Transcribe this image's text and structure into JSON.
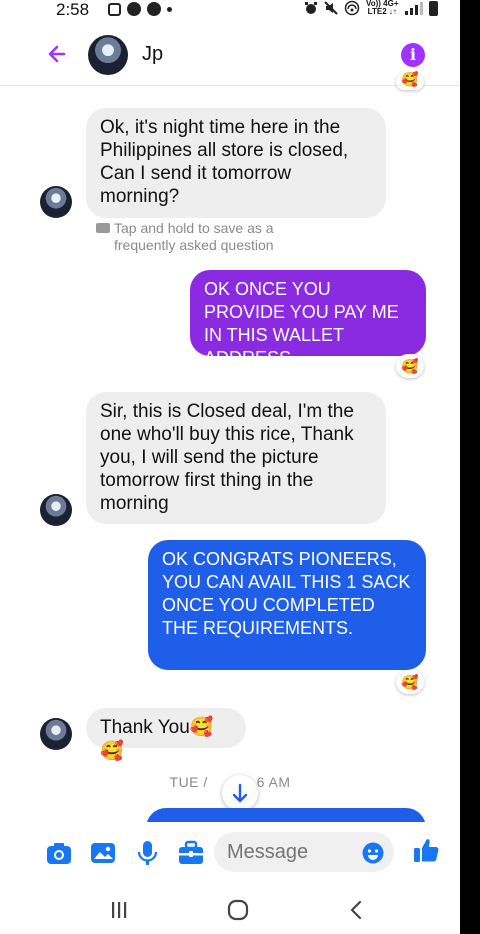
{
  "status_bar": {
    "time": "2:58",
    "network_top": "Vo)) 4G+",
    "network_bottom": "LTE2 ↓↑"
  },
  "header": {
    "contact_name": "Jp"
  },
  "messages": [
    {
      "direction": "incoming",
      "text": "Ok, it's night time here in the Philippines all store is closed, Can I send it tomorrow morning?"
    },
    {
      "direction": "outgoing",
      "text": "OK ONCE YOU PROVIDE YOU PAY ME IN THIS WALLET ADDRESS",
      "reaction": "🥰"
    },
    {
      "direction": "incoming",
      "text": "Sir, this is Closed deal, I'm the one who'll buy this rice, Thank you, I will send the picture tomorrow first thing in the morning"
    },
    {
      "direction": "outgoing",
      "text": "OK CONGRATS PIONEERS, YOU CAN AVAIL THIS 1 SACK ONCE YOU COMPLETED THE REQUIREMENTS.",
      "reaction": "🥰"
    },
    {
      "direction": "incoming",
      "text": "Thank You🥰🥰"
    }
  ],
  "faq_hint": {
    "line1": "Tap and hold to save as a",
    "line2": "frequently asked question"
  },
  "timestamp": {
    "left": "TUE /",
    "right": "6 AM"
  },
  "composer": {
    "placeholder": "Message"
  },
  "colors": {
    "accent_purple": "#a033ff",
    "outgoing_purple": "#8a2be2",
    "outgoing_blue": "#1e5ee8",
    "messenger_blue": "#1877f2"
  },
  "icons": [
    "back-arrow-icon",
    "info-icon",
    "camera-icon",
    "gallery-icon",
    "microphone-icon",
    "toolbox-icon",
    "emoji-icon",
    "thumbs-up-icon",
    "recents-icon",
    "home-icon",
    "back-icon"
  ]
}
